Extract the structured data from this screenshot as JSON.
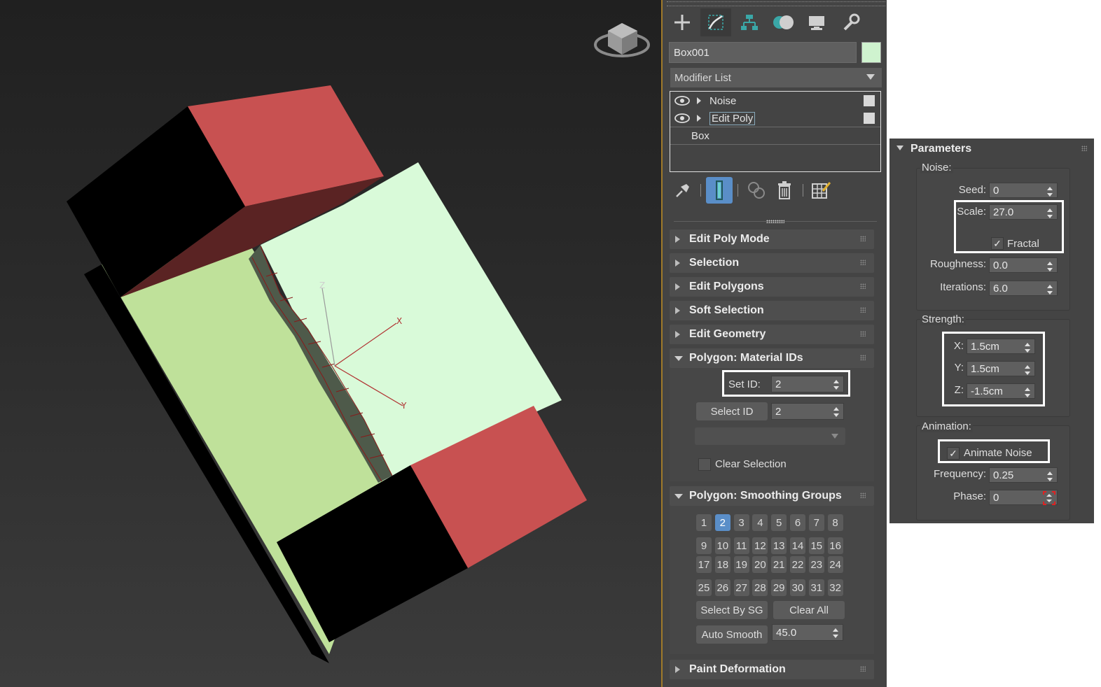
{
  "viewport": {
    "axis_labels": {
      "z": "Z",
      "x": "X",
      "y": "Y"
    },
    "colors": {
      "top_face": "#d9fad9",
      "side_face": "#bfe19a",
      "cap_red": "#c85151",
      "cap_black": "#000000"
    }
  },
  "command_panel": {
    "tabs": [
      "create-icon",
      "modify-icon",
      "hierarchy-icon",
      "motion-icon",
      "display-icon",
      "utilities-icon"
    ],
    "object_name": "Box001",
    "object_color": "#cff3cf",
    "modifier_list_label": "Modifier List",
    "stack": {
      "items": [
        {
          "label": "Noise"
        },
        {
          "label": "Edit Poly"
        },
        {
          "label": "Box"
        }
      ]
    },
    "rollouts": {
      "edit_poly_mode": "Edit Poly Mode",
      "selection": "Selection",
      "edit_polygons": "Edit Polygons",
      "soft_selection": "Soft Selection",
      "edit_geometry": "Edit Geometry",
      "material_ids": "Polygon: Material IDs",
      "smoothing_groups": "Polygon: Smoothing Groups",
      "paint_deformation": "Paint Deformation"
    },
    "material_ids": {
      "set_id_label": "Set ID:",
      "set_id_value": "2",
      "select_id_button": "Select ID",
      "select_id_value": "2",
      "clear_selection_label": "Clear Selection"
    },
    "smoothing_groups": {
      "groups": [
        "1",
        "2",
        "3",
        "4",
        "5",
        "6",
        "7",
        "8",
        "9",
        "10",
        "11",
        "12",
        "13",
        "14",
        "15",
        "16",
        "17",
        "18",
        "19",
        "20",
        "21",
        "22",
        "23",
        "24",
        "25",
        "26",
        "27",
        "28",
        "29",
        "30",
        "31",
        "32"
      ],
      "active_group": "2",
      "select_by_sg": "Select By SG",
      "clear_all": "Clear All",
      "auto_smooth": "Auto Smooth",
      "auto_smooth_value": "45.0"
    }
  },
  "parameters": {
    "title": "Parameters",
    "noise_group": "Noise:",
    "seed_label": "Seed:",
    "seed_value": "0",
    "scale_label": "Scale:",
    "scale_value": "27.0",
    "fractal_label": "Fractal",
    "roughness_label": "Roughness:",
    "roughness_value": "0.0",
    "iterations_label": "Iterations:",
    "iterations_value": "6.0",
    "strength_group": "Strength:",
    "x_label": "X:",
    "x_value": "1.5cm",
    "y_label": "Y:",
    "y_value": "1.5cm",
    "z_label": "Z:",
    "z_value": "-1.5cm",
    "animation_group": "Animation:",
    "animate_noise_label": "Animate Noise",
    "frequency_label": "Frequency:",
    "frequency_value": "0.25",
    "phase_label": "Phase:",
    "phase_value": "0"
  }
}
